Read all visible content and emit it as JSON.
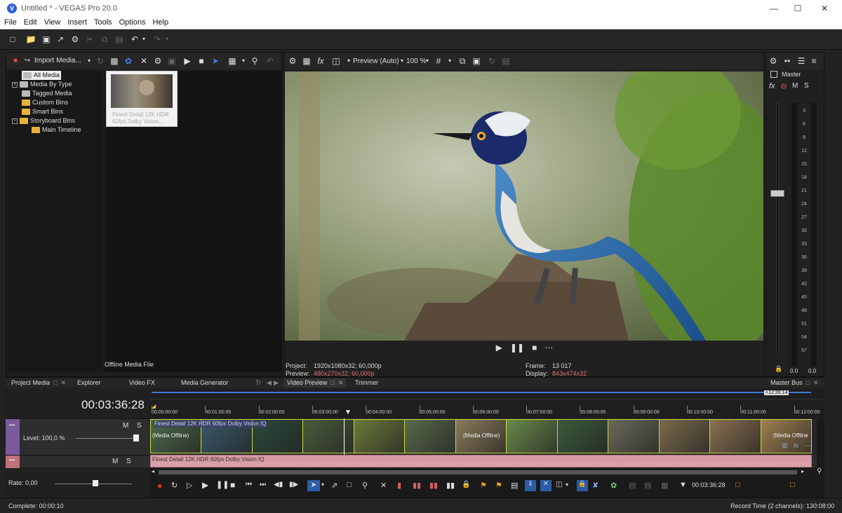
{
  "window": {
    "title": "Untitled * - VEGAS Pro 20.0",
    "logo": "V",
    "buttons": [
      "—",
      "☐",
      "✕"
    ]
  },
  "menu": [
    "File",
    "Edit",
    "View",
    "Insert",
    "Tools",
    "Options",
    "Help"
  ],
  "explorer": {
    "import_label": "Import Media...",
    "tree": [
      {
        "label": "All Media",
        "selected": true
      },
      {
        "label": "Media By Type",
        "expandable": true
      },
      {
        "label": "Tagged Media"
      },
      {
        "label": "Custom Bins"
      },
      {
        "label": "Smart Bins"
      },
      {
        "label": "Storyboard Bins",
        "expandable": true
      },
      {
        "label": "Main Timeline",
        "child": true
      }
    ],
    "thumb_caption": "Finest Detail 12K HDR 60fps  Dolby Vision...",
    "footer_label": "Offline Media File"
  },
  "preview": {
    "mode": "Preview (Auto)",
    "zoom": "100 %",
    "project_label": "Project:",
    "project_value": "1920x1080x32; 60,000p",
    "preview_label": "Preview:",
    "preview_value": "480x270x32; 60,000p",
    "frame_label": "Frame:",
    "frame_value": "13 017",
    "display_label": "Display:",
    "display_value": "843x474x32"
  },
  "master": {
    "title": "Master",
    "fx": "fx",
    "m": "M",
    "s": "S",
    "scale": [
      "3",
      "6",
      "9",
      "12",
      "15",
      "18",
      "21",
      "24",
      "27",
      "30",
      "33",
      "36",
      "39",
      "42",
      "45",
      "48",
      "51",
      "54",
      "57"
    ],
    "left_value": "0.0",
    "right_value": "0.0"
  },
  "tabs": [
    {
      "label": "Project Media",
      "closable": true
    },
    {
      "label": "Explorer"
    },
    {
      "label": "Video FX"
    },
    {
      "label": "Media Generator"
    },
    {
      "label": "Tr"
    },
    {
      "label": "Video Preview",
      "closable": true,
      "active": true
    },
    {
      "label": "Trimmer"
    },
    {
      "label": "Master Bus",
      "closable": true
    }
  ],
  "timeline": {
    "timecode": "00:03:36:28",
    "ruler_marker": "+12:26:14",
    "ticks": [
      "00:00:00:00",
      "00:01:00:00",
      "00:02:00:00",
      "00:03:00:00",
      "00:04:00:00",
      "00:05:00:00",
      "00:06:00:00",
      "00:07:00:00",
      "00:08:00:00",
      "00:09:00:00",
      "00:10:00:00",
      "00:11:00:00",
      "00:12:00:00"
    ],
    "video_track": {
      "m": "M",
      "s": "S",
      "level": "Level: 100,0 %"
    },
    "audio_track": {
      "m": "M",
      "s": "S"
    },
    "clip_title": "Finest Detail 12K HDR 60fps  Dolby Vision IQ",
    "media_offline": "(Media Offline)",
    "media_offline_short": "(Media Offline",
    "rate": "Rate: 0,00",
    "cursor_time": "00:03:36:28",
    "clip_colors": [
      "#4a6a4a",
      "#3a5a6a",
      "#2a4a3a",
      "#4a5a3a",
      "#6a7a3a",
      "#5a6a4a",
      "#8a7a5a",
      "#6a8a4a",
      "#3a5a3a",
      "#6a6a5a",
      "#7a6a4a",
      "#8a7050",
      "#a08050"
    ]
  },
  "status": {
    "complete": "Complete: 00:00:10",
    "record_time": "Record Time (2 channels): 130:08:00"
  },
  "colors": {
    "accent": "#2f5fd8",
    "clip_border": "#c8d840",
    "preview_value": "#e07070"
  }
}
